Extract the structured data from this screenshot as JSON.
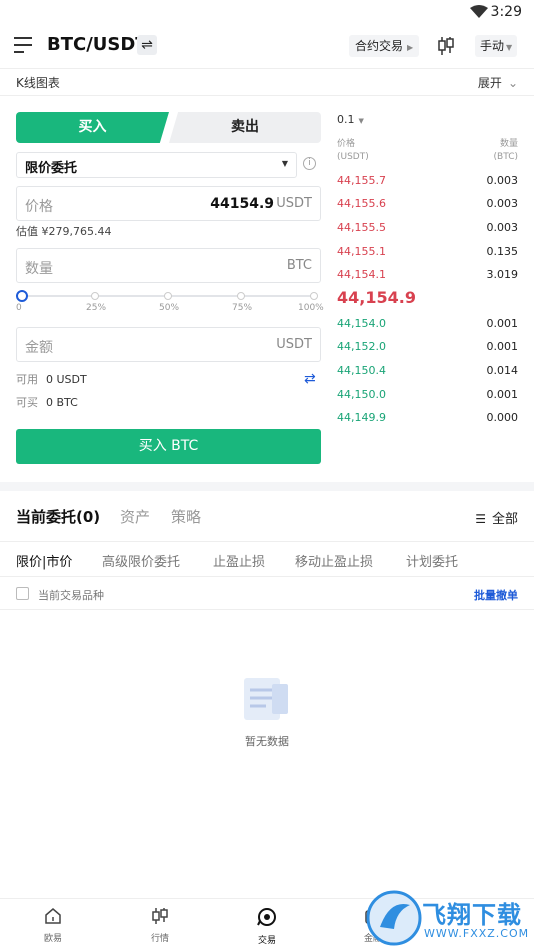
{
  "status": {
    "time": "3:29"
  },
  "header": {
    "pair": "BTC/USDT",
    "swap_glyph": "⇌",
    "contract_label": "合约交易",
    "manual_label": "手动"
  },
  "kline": {
    "label": "K线图表",
    "expand_label": "展开"
  },
  "trade": {
    "buy_tab": "买入",
    "sell_tab": "卖出",
    "order_type": "限价委托",
    "price_placeholder": "价格",
    "price_value": "44154.9",
    "price_unit": "USDT",
    "estimate": "估值 ¥279,765.44",
    "qty_placeholder": "数量",
    "qty_unit": "BTC",
    "slider_ticks": [
      "0",
      "25%",
      "50%",
      "75%",
      "100%"
    ],
    "slider_value_pct": 0,
    "amount_placeholder": "金额",
    "amount_unit": "USDT",
    "available_label": "可用",
    "available_value": "0 USDT",
    "buyable_label": "可买",
    "buyable_value": "0 BTC",
    "buy_button": "买入 BTC"
  },
  "orderbook": {
    "depth": "0.1",
    "price_header": "价格",
    "price_header_unit": "(USDT)",
    "qty_header": "数量",
    "qty_header_unit": "(BTC)",
    "asks": [
      {
        "price": "44,155.7",
        "qty": "0.003"
      },
      {
        "price": "44,155.6",
        "qty": "0.003"
      },
      {
        "price": "44,155.5",
        "qty": "0.003"
      },
      {
        "price": "44,155.1",
        "qty": "0.135"
      },
      {
        "price": "44,154.1",
        "qty": "3.019"
      }
    ],
    "last_price": "44,154.9",
    "bids": [
      {
        "price": "44,154.0",
        "qty": "0.001"
      },
      {
        "price": "44,152.0",
        "qty": "0.001"
      },
      {
        "price": "44,150.4",
        "qty": "0.014"
      },
      {
        "price": "44,150.0",
        "qty": "0.001"
      },
      {
        "price": "44,149.9",
        "qty": "0.000"
      }
    ]
  },
  "orders": {
    "tabs": [
      "当前委托(0)",
      "资产",
      "策略"
    ],
    "all_label": "全部",
    "sub_tabs": [
      "限价|市价",
      "高级限价委托",
      "止盈止损",
      "移动止盈止损",
      "计划委托"
    ],
    "filter_label": "当前交易品种",
    "batch_cancel": "批量撤单",
    "empty_text": "暂无数据"
  },
  "nav": {
    "items": [
      "欧易",
      "行情",
      "交易",
      "金融"
    ]
  },
  "watermark": {
    "site": "飞翔下载",
    "url": "WWW.FXXZ.COM"
  },
  "colors": {
    "green": "#19b77d",
    "red": "#d8414f",
    "blue": "#1e5bd8"
  }
}
